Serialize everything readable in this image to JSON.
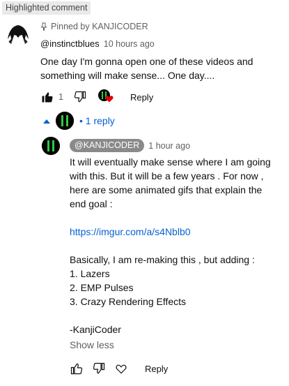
{
  "badge": "Highlighted comment",
  "comment": {
    "pinned_text": "Pinned by KANJICODER",
    "author": "@instinctblues",
    "time": "10 hours ago",
    "text": "One day I'm gonna open one of these videos and something will make sense... One day....",
    "like_count": "1",
    "reply_label": "Reply"
  },
  "replies_toggle": {
    "label": "• 1 reply"
  },
  "reply": {
    "author": "@KANJICODER",
    "time": "1 hour ago",
    "lines": [
      "It will eventually make sense where I am going with this. But it will be a few years . For now , here are some animated gifs that explain the end goal :",
      "",
      "https://imgur.com/a/s4Nblb0",
      "",
      "Basically, I am re-making this , but adding :",
      "1. Lazers",
      "2. EMP Pulses",
      "3. Crazy Rendering Effects",
      "",
      "-KanjiCoder"
    ],
    "show_less": "Show less",
    "reply_label": "Reply"
  },
  "colors": {
    "link": "#065fd4",
    "heart": "#e00000",
    "chip": "#8a8a8a"
  }
}
